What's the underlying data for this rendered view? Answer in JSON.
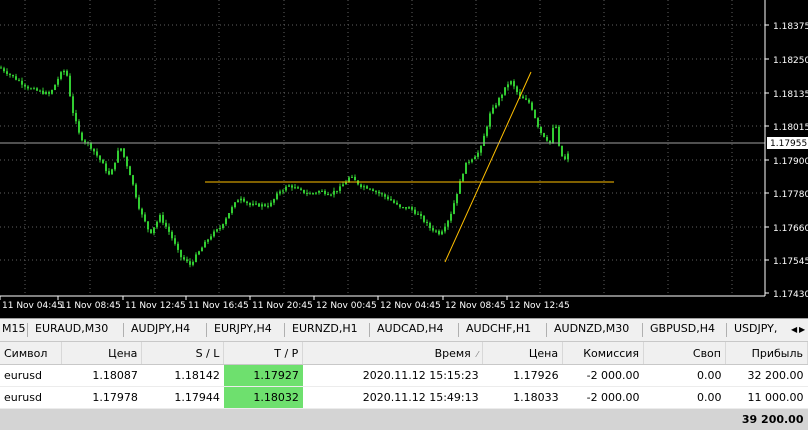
{
  "chart": {
    "price_scale": [
      "1.18375",
      "1.18250",
      "1.18135",
      "1.18015",
      "1.17900",
      "1.17780",
      "1.17660",
      "1.17545",
      "1.17430"
    ],
    "current_price": "1.17955",
    "time_labels": [
      "11 Nov 04:45",
      "11 Nov 08:45",
      "11 Nov 12:45",
      "11 Nov 16:45",
      "11 Nov 20:45",
      "12 Nov 00:45",
      "12 Nov 04:45",
      "12 Nov 08:45",
      "12 Nov 12:45"
    ],
    "background_color": "#000000",
    "candle_color": "#32cd32",
    "line_color": "#ffc000"
  },
  "tabs": [
    "M15",
    "EURAUD,M30",
    "AUDJPY,H4",
    "EURJPY,H4",
    "EURNZD,H1",
    "AUDCAD,H4",
    "AUDCHF,H1",
    "AUDNZD,M30",
    "GBPUSD,H4",
    "USDJPY,"
  ],
  "tab_scroll": {
    "left": "◀",
    "right": "▶"
  },
  "terminal": {
    "headers": {
      "symbol": "Символ",
      "price": "Цена",
      "sl": "S / L",
      "tp": "T / P",
      "time": "Время",
      "sort_icon": "⁄",
      "close_price": "Цена",
      "commission": "Комиссия",
      "swap": "Своп",
      "profit": "Прибыль"
    },
    "rows": [
      {
        "symbol": "eurusd",
        "price": "1.18087",
        "sl": "1.18142",
        "tp": "1.17927",
        "time": "2020.11.12 15:15:23",
        "close_price": "1.17926",
        "commission": "-2 000.00",
        "swap": "0.00",
        "profit": "32 200.00"
      },
      {
        "symbol": "eurusd",
        "price": "1.17978",
        "sl": "1.17944",
        "tp": "1.18032",
        "time": "2020.11.12 15:49:13",
        "close_price": "1.18033",
        "commission": "-2 000.00",
        "swap": "0.00",
        "profit": "11 000.00"
      }
    ],
    "total": "39 200.00"
  }
}
